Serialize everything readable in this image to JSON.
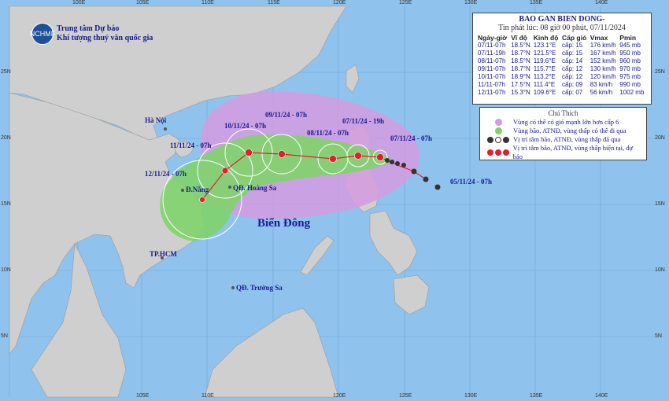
{
  "agency": {
    "logo_text": "NCHMF",
    "line1": "Trung tâm Dự báo",
    "line2": "Khí tượng thuỷ văn quốc gia"
  },
  "bulletin": {
    "title": "BAO GAN BIEN DONG-",
    "issued": "Tin phát lúc: 08 giờ 00 phút, 07/11/2024",
    "headers": [
      "Ngày-giờ",
      "Vĩ độ",
      "Kinh độ",
      "Cấp gió",
      "Vmax",
      "Pmin"
    ],
    "rows": [
      [
        "07/11-07h",
        "18.5°N",
        "123.1°E",
        "cấp: 15",
        "176 km/h",
        "945 mb"
      ],
      [
        "07/11-19h",
        "18.7°N",
        "121.5°E",
        "cấp: 15",
        "167 km/h",
        "950 mb"
      ],
      [
        "08/11-07h",
        "18.5°N",
        "119.6°E",
        "cấp: 14",
        "152 km/h",
        "960 mb"
      ],
      [
        "09/11-07h",
        "18.7°N",
        "115.7°E",
        "cấp: 12",
        "130 km/h",
        "970 mb"
      ],
      [
        "10/11-07h",
        "18.9°N",
        "113.2°E",
        "cấp: 12",
        "120 km/h",
        "975 mb"
      ],
      [
        "11/11-07h",
        "17.5°N",
        "111.4°E",
        "cấp: 09",
        "83 km/h",
        "990 mb"
      ],
      [
        "12/11-07h",
        "15.3°N",
        "109.6°E",
        "cấp: 07",
        "56 km/h",
        "1002 mb"
      ]
    ]
  },
  "legend": {
    "title": "Chú Thích",
    "items": [
      "Vùng có thể có gió mạnh lớn hơn cấp 6",
      "Vùng bão, ATNĐ, vùng thấp có thể đi qua",
      "Vị trí tâm bão, ATNĐ, vùng thấp đã qua",
      "Vị trí tâm bão, ATNĐ, vùng thấp hiện tại, dự báo"
    ],
    "colors": {
      "wind_zone": "#d59be0",
      "track_zone": "#7fd36a",
      "past": "#333333",
      "forecast": "#e0202a"
    }
  },
  "map_labels": {
    "sea": "Biển Đông",
    "hanoi": "Hà Nội",
    "danang": "Đ.Nẵng",
    "hcm": "TP.HCM",
    "hoangsa": "QĐ. Hoàng Sa",
    "truongsa": "QĐ. Trường Sa"
  },
  "track_labels": {
    "p1": "05/11/24 - 07h",
    "p2": "07/11/24 - 07h",
    "p3": "07/11/24 - 19h",
    "p4": "08/11/24 - 07h",
    "p5": "09/11/24 - 07h",
    "p6": "10/11/24 - 07h",
    "p7": "11/11/24 - 07h",
    "p8": "12/11/24 - 07h"
  },
  "axis": {
    "top": [
      "100E",
      "105E",
      "110E",
      "115E",
      "120E",
      "125E",
      "130E",
      "135E",
      "140E"
    ],
    "bottom": [
      "105E",
      "110E",
      "120E",
      "125E",
      "130E",
      "135E",
      "140E"
    ],
    "left": [
      "25N",
      "20N",
      "15N",
      "10N",
      "5N"
    ],
    "right": [
      "25N",
      "20N",
      "15N",
      "10N",
      "5N"
    ]
  }
}
